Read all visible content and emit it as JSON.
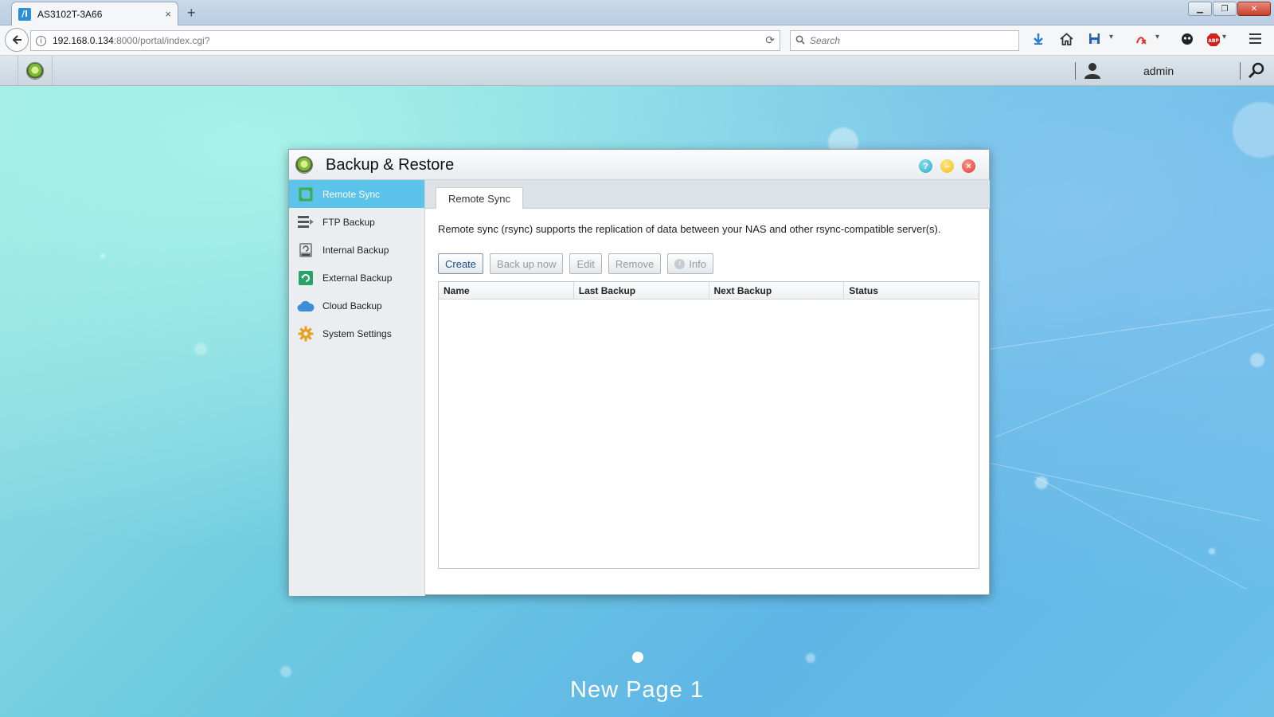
{
  "browser": {
    "tab_title": "AS3102T-3A66",
    "tab_favicon": "/l",
    "tab_close": "×",
    "new_tab": "+",
    "url_host": "192.168.0.134",
    "url_rest": ":8000/portal/index.cgi?",
    "search_placeholder": "Search",
    "toolbar_icons": [
      "back-arrow-icon",
      "download-icon",
      "home-icon",
      "save-icon",
      "pdf-icon",
      "extension-icon",
      "adblock-icon",
      "menu-icon"
    ]
  },
  "portal": {
    "user_label": "admin"
  },
  "window": {
    "title": "Backup & Restore",
    "help": "?",
    "minimize": "–",
    "close": "×"
  },
  "sidebar": {
    "items": [
      {
        "label": "Remote Sync",
        "icon": "remote-sync-icon",
        "active": true
      },
      {
        "label": "FTP Backup",
        "icon": "ftp-backup-icon"
      },
      {
        "label": "Internal Backup",
        "icon": "internal-backup-icon"
      },
      {
        "label": "External Backup",
        "icon": "external-backup-icon"
      },
      {
        "label": "Cloud Backup",
        "icon": "cloud-backup-icon"
      },
      {
        "label": "System Settings",
        "icon": "gear-icon"
      }
    ]
  },
  "main": {
    "tab_label": "Remote Sync",
    "description": "Remote sync (rsync) supports the replication of data between your NAS and other rsync-compatible server(s).",
    "buttons": {
      "create": "Create",
      "backup_now": "Back up now",
      "edit": "Edit",
      "remove": "Remove",
      "info": "Info",
      "info_glyph": "i"
    },
    "table": {
      "columns": [
        "Name",
        "Last Backup",
        "Next Backup",
        "Status"
      ],
      "rows": []
    }
  },
  "desktop": {
    "page_label": "New Page 1"
  },
  "colors": {
    "sidebar_active": "#5cc3ea",
    "enabled_button_text": "#1d4e82"
  }
}
